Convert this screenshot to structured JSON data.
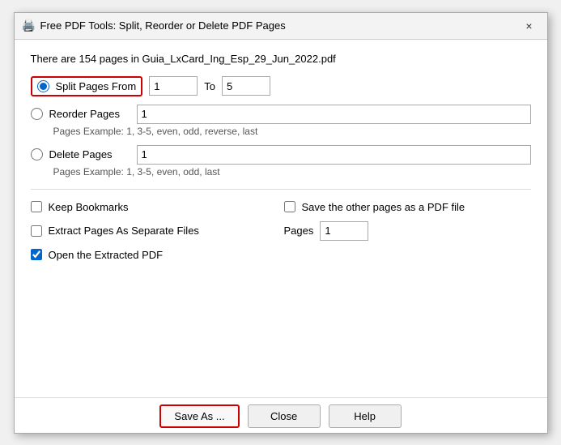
{
  "titleBar": {
    "icon": "📄",
    "title": "Free PDF Tools: Split, Reorder or Delete PDF Pages",
    "closeLabel": "×"
  },
  "info": {
    "text": "There are 154 pages in Guia_LxCard_Ing_Esp_29_Jun_2022.pdf"
  },
  "splitPages": {
    "label": "Split Pages From",
    "fromValue": "1",
    "toLabel": "To",
    "toValue": "5"
  },
  "reorderPages": {
    "label": "Reorder Pages",
    "value": "1",
    "example": "Pages Example: 1, 3-5, even, odd, reverse, last"
  },
  "deletePages": {
    "label": "Delete Pages",
    "value": "1",
    "example": "Pages Example: 1, 3-5, even, odd, last"
  },
  "options": {
    "keepBookmarks": "Keep Bookmarks",
    "saveOtherPages": "Save the other pages as a PDF file",
    "extractSeparate": "Extract Pages As Separate Files",
    "pagesLabel": "Pages",
    "pagesValue": "1",
    "openExtracted": "Open the Extracted PDF"
  },
  "buttons": {
    "saveAs": "Save As ...",
    "close": "Close",
    "help": "Help"
  }
}
